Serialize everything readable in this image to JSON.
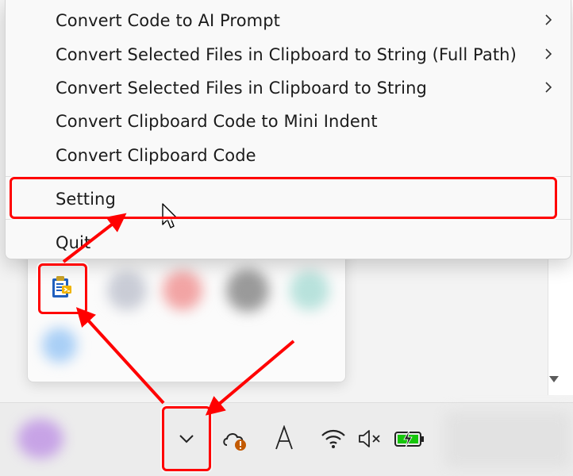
{
  "context_menu": {
    "items": [
      {
        "label": "Convert Code to AI Prompt",
        "has_submenu": true,
        "icon": "chevron-right-icon"
      },
      {
        "label": "Convert Selected Files in Clipboard to String (Full Path)",
        "has_submenu": true,
        "icon": "chevron-right-icon"
      },
      {
        "label": "Convert Selected Files in Clipboard to String",
        "has_submenu": true,
        "icon": "chevron-right-icon"
      },
      {
        "label": "Convert Clipboard Code to Mini Indent",
        "has_submenu": false
      },
      {
        "label": "Convert Clipboard Code",
        "has_submenu": false
      },
      {
        "label": "Setting",
        "has_submenu": false,
        "highlighted": true
      },
      {
        "label": "Quit",
        "has_submenu": false
      }
    ]
  },
  "overflow_flyout": {
    "app_icon": "clipboard-code-app-icon"
  },
  "taskbar": {
    "icons": [
      "show-hidden-icons-chevron-icon",
      "onedrive-warning-icon",
      "input-method-a-icon",
      "wifi-icon",
      "speaker-muted-icon",
      "battery-charging-icon"
    ]
  },
  "colors": {
    "annotation": "#ff0000",
    "menu_background": "#f9f9f9",
    "taskbar_background": "#ececec",
    "battery_green": "#16c60c"
  }
}
